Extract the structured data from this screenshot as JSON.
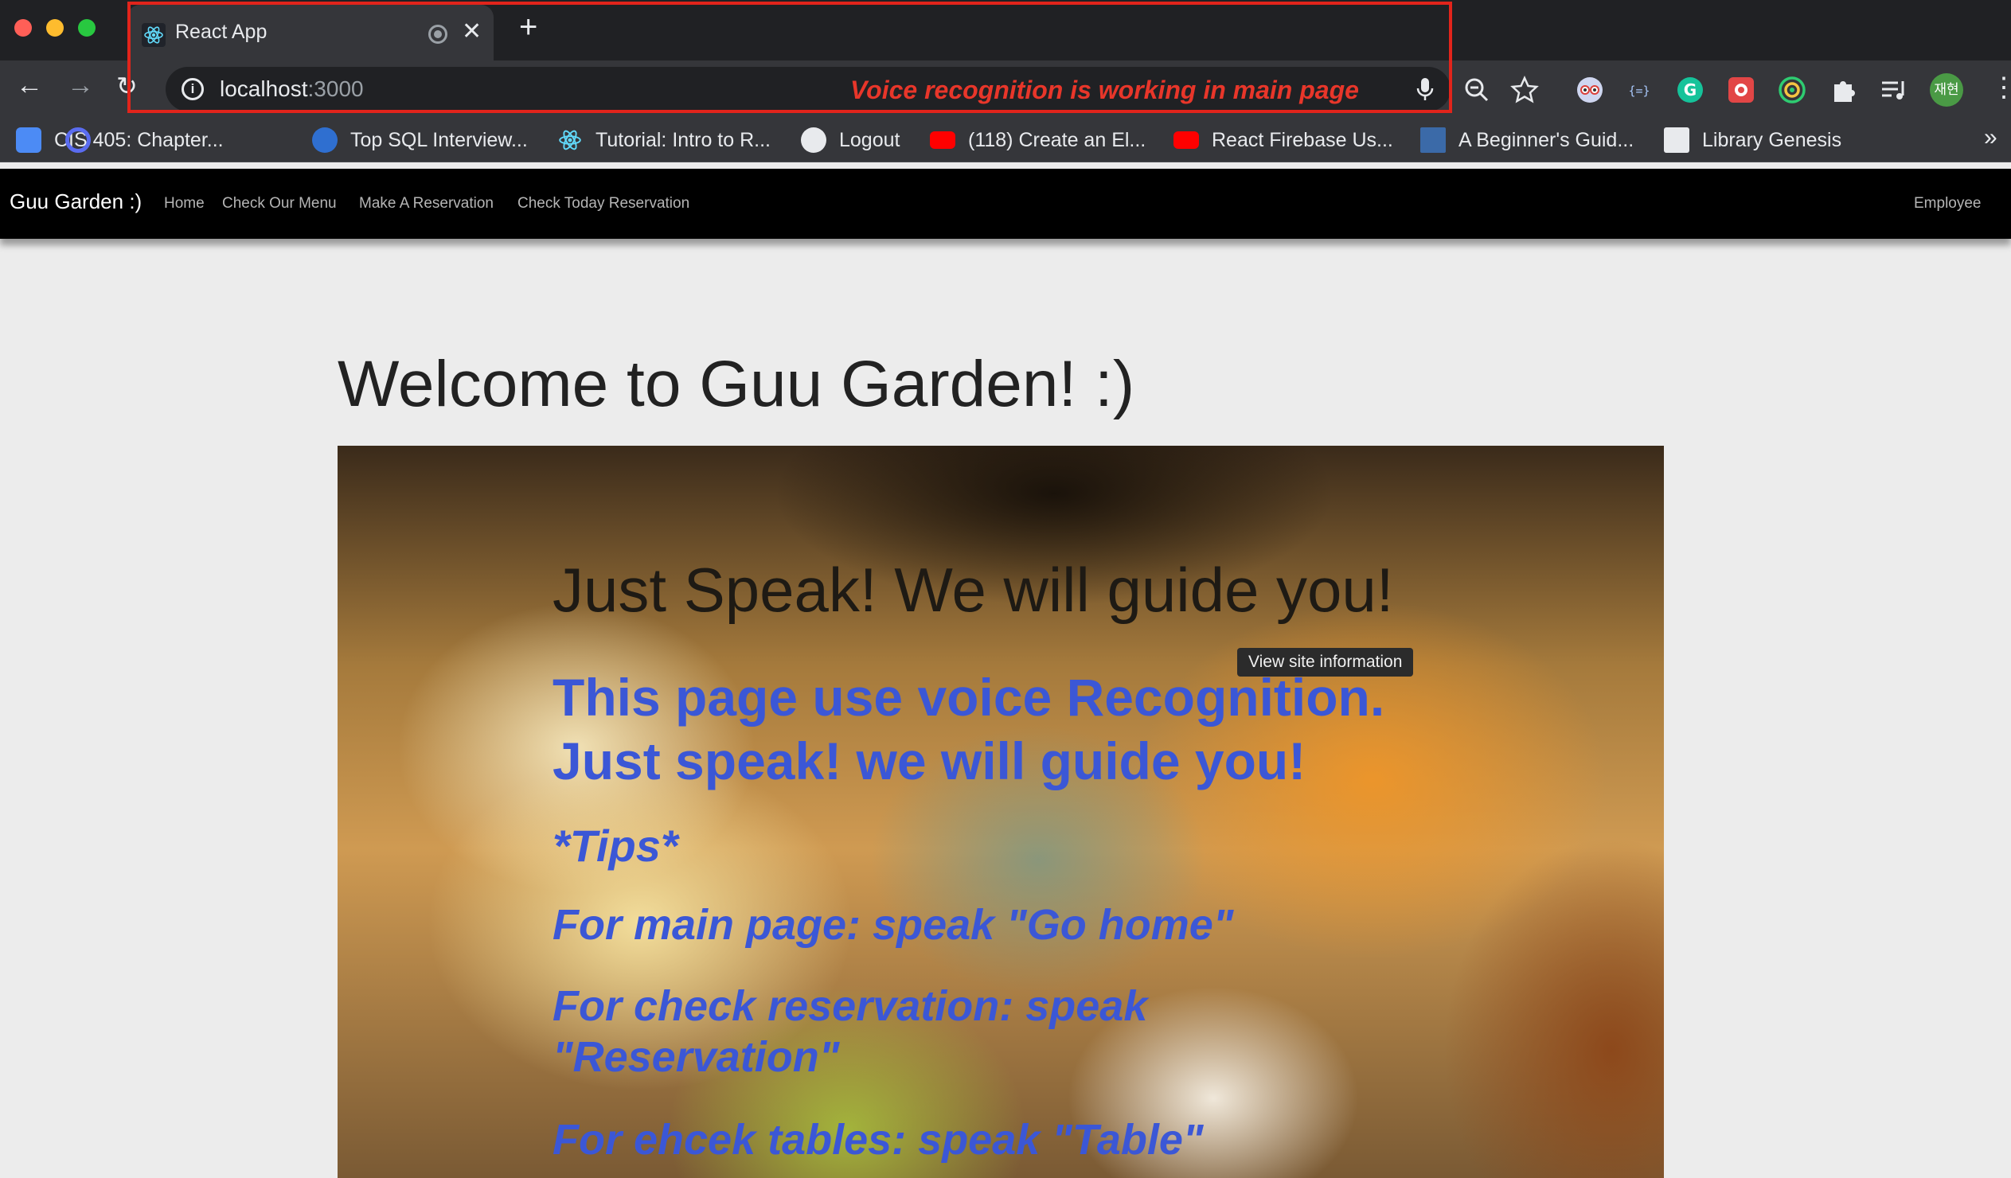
{
  "browser": {
    "tab_title": "React App",
    "url_host": "localhost",
    "url_port": ":3000",
    "annotation": "Voice recognition is working in main page",
    "avatar_text": "재현",
    "tooltip": "View site information",
    "bookmarks": [
      {
        "label": "CIS 405: Chapter...",
        "icon": "docs-icon",
        "color": "#4c8bf5"
      },
      {
        "label": "Top SQL Interview...",
        "icon": "q-icon",
        "color": "#5a6cf0"
      },
      {
        "label": "Tutorial: Intro to R...",
        "icon": "react-icon",
        "color": "#61dafb"
      },
      {
        "label": "Logout",
        "icon": "globe-icon",
        "color": "#e8eaed"
      },
      {
        "label": "(118) Create an El...",
        "icon": "youtube-icon",
        "color": "#ff0000"
      },
      {
        "label": "React Firebase Us...",
        "icon": "youtube-icon",
        "color": "#ff0000"
      },
      {
        "label": "A Beginner's Guid...",
        "icon": "book-icon",
        "color": "#3b6aa8"
      },
      {
        "label": "Library Genesis",
        "icon": "libgen-icon",
        "color": "#e8eaed"
      }
    ]
  },
  "site": {
    "brand": "Guu Garden :)",
    "nav": [
      "Home",
      "Check Our Menu",
      "Make A Reservation",
      "Check Today Reservation"
    ],
    "nav_right": "Employee",
    "welcome": "Welcome to Guu Garden! :)",
    "hero": {
      "title": "Just Speak! We will guide you!",
      "lead_1": "This page use voice Recognition.",
      "lead_2": "Just speak! we will guide you!",
      "tips": "*Tips*",
      "tip_1": "For main page: speak \"Go home\"",
      "tip_2a": "For check reservation: speak",
      "tip_2b": "\"Reservation\"",
      "tip_3": "For ehcek tables: speak \"Table\""
    }
  },
  "colors": {
    "annotation": "#e8362a",
    "hero_text_blue": "#3b57d6",
    "navbar": "#000000",
    "page_bg": "#ececec"
  }
}
